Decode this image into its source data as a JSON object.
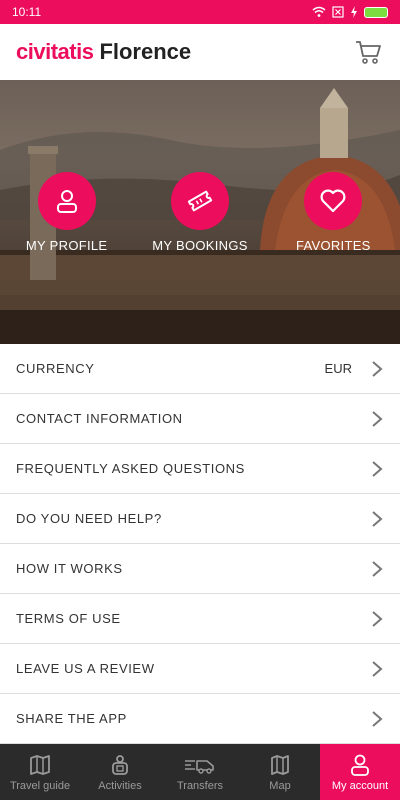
{
  "status": {
    "time": "10:11"
  },
  "header": {
    "brand": "civitatis",
    "city": "Florence"
  },
  "hero": {
    "actions": [
      {
        "label": "MY PROFILE",
        "icon": "user-icon"
      },
      {
        "label": "MY BOOKINGS",
        "icon": "ticket-icon"
      },
      {
        "label": "FAVORITES",
        "icon": "heart-icon"
      }
    ]
  },
  "menu": {
    "items": [
      {
        "label": "CURRENCY",
        "value": "EUR"
      },
      {
        "label": "CONTACT INFORMATION"
      },
      {
        "label": "FREQUENTLY ASKED QUESTIONS"
      },
      {
        "label": "DO YOU NEED HELP?"
      },
      {
        "label": "HOW IT WORKS"
      },
      {
        "label": "TERMS OF USE"
      },
      {
        "label": "LEAVE US A REVIEW"
      },
      {
        "label": "SHARE THE APP"
      }
    ]
  },
  "bottomnav": {
    "tabs": [
      {
        "label": "Travel guide",
        "icon": "map-fold-icon"
      },
      {
        "label": "Activities",
        "icon": "activity-icon"
      },
      {
        "label": "Transfers",
        "icon": "transfer-icon"
      },
      {
        "label": "Map",
        "icon": "map-icon"
      },
      {
        "label": "My account",
        "icon": "user-icon"
      }
    ]
  },
  "colors": {
    "accent": "#ec0d5c",
    "nav_bg": "#2b2b2b"
  }
}
